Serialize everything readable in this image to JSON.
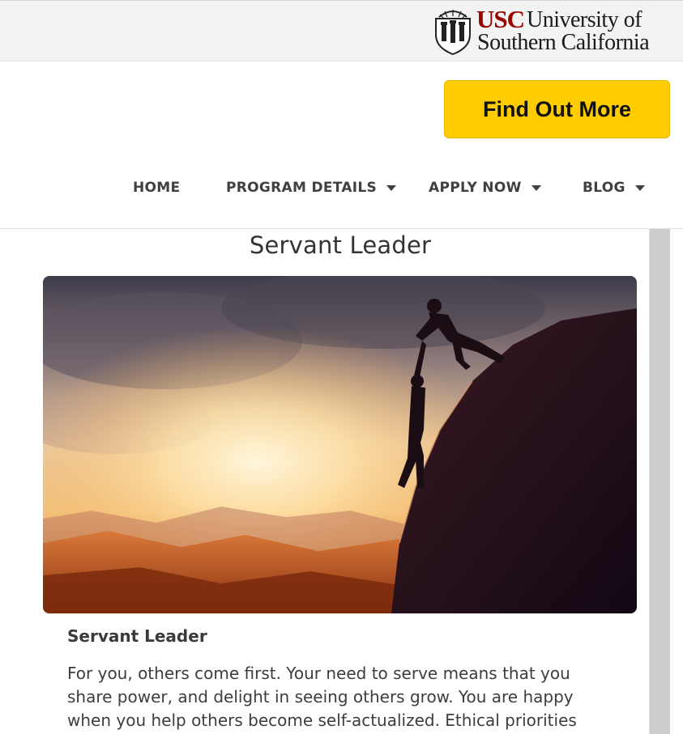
{
  "brand": {
    "abbrev": "USC",
    "name_line1": "University of",
    "name_line2": "Southern California",
    "accent_color": "#990000"
  },
  "cta": {
    "label": "Find Out More",
    "color": "#ffcc00"
  },
  "nav": {
    "items": [
      {
        "label": "HOME",
        "has_dropdown": false
      },
      {
        "label": "PROGRAM DETAILS",
        "has_dropdown": true
      },
      {
        "label": "APPLY NOW",
        "has_dropdown": true
      },
      {
        "label": "BLOG",
        "has_dropdown": true
      }
    ],
    "dropdown_icon": "caret-down-icon"
  },
  "content": {
    "title": "Servant Leader",
    "image_icon": "climbers-helping-hand-image",
    "subtitle": "Servant Leader",
    "body_lines": [
      "For you, others come first. Your need to serve means that you",
      "share power, and delight in seeing others grow. You are happy",
      "when you help others become self-actualized. Ethical priorities"
    ]
  }
}
